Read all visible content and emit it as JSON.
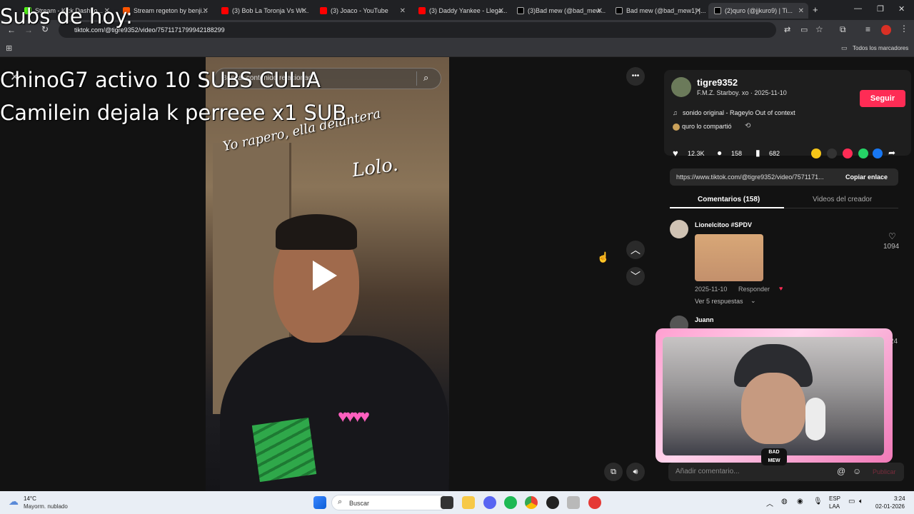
{
  "browser": {
    "tabs": [
      {
        "title": "Stream - Kick Dashbo...",
        "color": "#53fc18"
      },
      {
        "title": "Stream regeton by benji...",
        "color": "#ff5500"
      },
      {
        "title": "(3) Bob La Toronja Vs Wi...",
        "color": "#ff0000"
      },
      {
        "title": "(3) Joaco - YouTube",
        "color": "#ff0000"
      },
      {
        "title": "(3) Daddy Yankee - Llega...",
        "color": "#ff0000"
      },
      {
        "title": "(3)Bad mew (@bad_mew...",
        "color": "#000000"
      },
      {
        "title": "Bad mew (@bad_mew1) |...",
        "color": "#000000"
      },
      {
        "title": "(2)quro (@jjkuro9) | Ti...",
        "color": "#000000"
      }
    ],
    "new_tab": "+",
    "url": "tiktok.com/@tigre9352/video/7571171799942188299",
    "bookmarks_label": "Todos los marcadores"
  },
  "overlay": {
    "title": "Subs de hoy:",
    "lines": [
      "ChinoG7 activo 10 SUBS CULIA",
      "Camilein dejala k perreee x1 SUB"
    ]
  },
  "video": {
    "search_placeholder": "Buscar contenido relacionado",
    "caption_1": "Yo rapero, ella delantera",
    "caption_2": "Lolo.",
    "more": "•••"
  },
  "creator": {
    "username": "tigre9352",
    "sub": "F.M.Z. Starboy. xo · 2025-11-10",
    "follow_label": "Seguir",
    "sound": "sonido original - Rageylo Out of context",
    "shared": "quro lo compartió"
  },
  "stats": {
    "likes": "12.3K",
    "comments": "158",
    "saves": "682"
  },
  "share": {
    "url": "https://www.tiktok.com/@tigre9352/video/7571171...",
    "copy_label": "Copiar enlace"
  },
  "tabs": {
    "comments": "Comentarios (158)",
    "creator_videos": "Videos del creador"
  },
  "comments": [
    {
      "user": "Lionelcitoo #SPDV",
      "date": "2025-11-10",
      "reply": "Responder",
      "replies": "Ver 5 respuestas",
      "likes": "1094"
    },
    {
      "user": "Juann",
      "likes": "24"
    }
  ],
  "comment_input": {
    "placeholder": "Añadir comentario...",
    "post": "Publicar"
  },
  "webcam": {
    "logo": "BAD MEW"
  },
  "taskbar": {
    "weather_temp": "14°C",
    "weather_desc": "Mayorm. nublado",
    "search": "Buscar",
    "lang": "ESP",
    "lang2": "LAA",
    "time": "3:24",
    "date": "02-01-2026"
  }
}
